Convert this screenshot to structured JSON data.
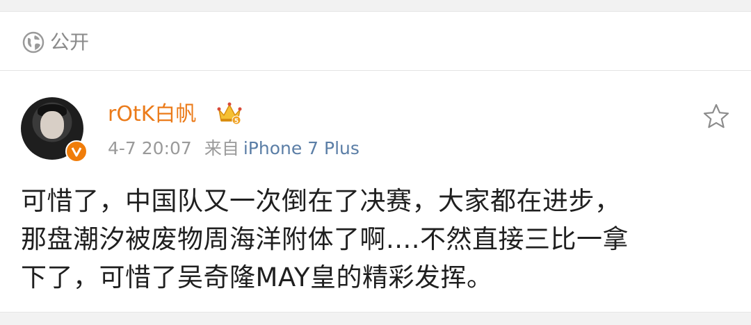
{
  "visibility": {
    "label": "公开",
    "icon": "globe-icon"
  },
  "post": {
    "username": "rOtK白帆",
    "time": "4-7 20:07",
    "from_label": "来自",
    "source": "iPhone 7 Plus",
    "body_lines": [
      "可惜了，中国队又一次倒在了决赛，大家都在进步，",
      "那盘潮汐被废物周海洋附体了啊....不然直接三比一拿",
      "下了，可惜了吴奇隆MAY皇的精彩发挥。"
    ],
    "icons": {
      "avatar_badge": "verified-v-icon",
      "member": "crown-icon",
      "favorite": "star-icon"
    }
  },
  "colors": {
    "username": "#eb7b1a",
    "source_link": "#5b7ea6",
    "meta_text": "#9a9a9a",
    "body_text": "#1f1f1f"
  }
}
